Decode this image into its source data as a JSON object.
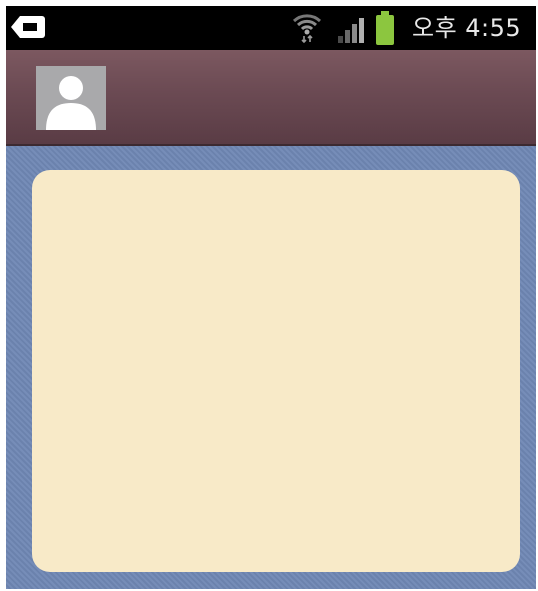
{
  "status_bar": {
    "time": "오후 4:55",
    "icons": [
      "back-notification-icon",
      "wifi-icon",
      "signal-icon",
      "battery-icon"
    ]
  },
  "header": {
    "avatar": "default-avatar-icon"
  },
  "colors": {
    "status_bar": "#000000",
    "header": "#6b4a53",
    "background": "#6f87b4",
    "card": "#f8eac8",
    "battery": "#8cc63f",
    "avatar_bg": "#a9a9ab"
  }
}
